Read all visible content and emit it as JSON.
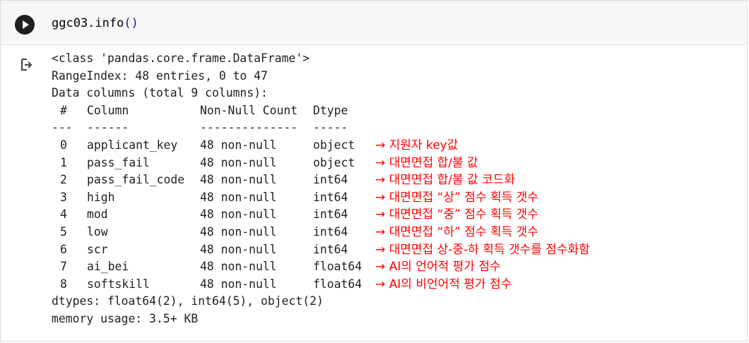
{
  "cell": {
    "code": "ggc03.info",
    "code_parens": "()"
  },
  "output": {
    "class_line": "<class 'pandas.core.frame.DataFrame'>",
    "range_index": "RangeIndex: 48 entries, 0 to 47",
    "data_columns": "Data columns (total 9 columns):",
    "headers": [
      "#",
      "Column",
      "Non-Null Count",
      "Dtype"
    ],
    "separators": [
      "---",
      "------",
      "--------------",
      "-----"
    ],
    "rows": [
      {
        "num": "0",
        "column": "applicant_key",
        "non_null": "48 non-null",
        "dtype": "object",
        "note": "→ 지원자 key값"
      },
      {
        "num": "1",
        "column": "pass_fail",
        "non_null": "48 non-null",
        "dtype": "object",
        "note": "→ 대면면접 합/불 값"
      },
      {
        "num": "2",
        "column": "pass_fail_code",
        "non_null": "48 non-null",
        "dtype": "int64",
        "note": "→ 대면면접 합/불 값 코드화"
      },
      {
        "num": "3",
        "column": "high",
        "non_null": "48 non-null",
        "dtype": "int64",
        "note": "→ 대면면접 “상” 점수 획득 갯수"
      },
      {
        "num": "4",
        "column": "mod",
        "non_null": "48 non-null",
        "dtype": "int64",
        "note": "→ 대면면접 “중” 점수 획득 갯수"
      },
      {
        "num": "5",
        "column": "low",
        "non_null": "48 non-null",
        "dtype": "int64",
        "note": "→ 대면면접 “하” 점수 획득 갯수"
      },
      {
        "num": "6",
        "column": "scr",
        "non_null": "48 non-null",
        "dtype": "int64",
        "note": "→ 대면면접 상-중-하 획득 갯수를 점수화함"
      },
      {
        "num": "7",
        "column": "ai_bei",
        "non_null": "48 non-null",
        "dtype": "float64",
        "note": "→ AI의 언어적 평가 점수"
      },
      {
        "num": "8",
        "column": "softskill",
        "non_null": "48 non-null",
        "dtype": "float64",
        "note": "→ AI의 비언어적 평가 점수"
      }
    ],
    "dtypes_line": "dtypes: float64(2), int64(5), object(2)",
    "memory_line": "memory usage: 3.5+ KB"
  },
  "icons": {
    "run": "play-circle-icon",
    "output": "output-arrow-icon"
  },
  "colors": {
    "annotation": "#ff0000",
    "run_button": "#1f1f1f",
    "paren": "#1a1aa6"
  }
}
